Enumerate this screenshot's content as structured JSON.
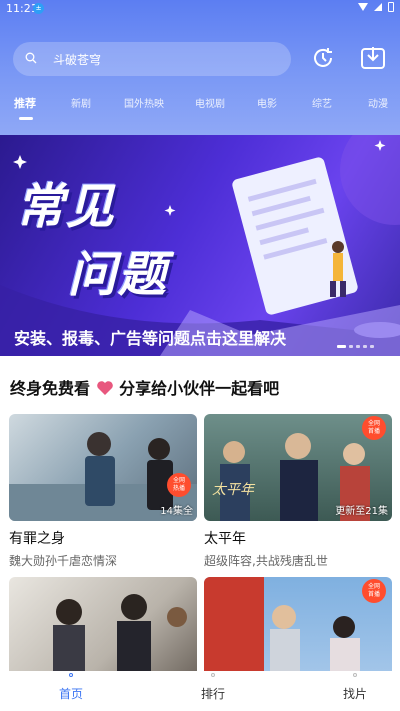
{
  "status": {
    "time": "11:21",
    "notif_glyph": "±"
  },
  "search": {
    "text": "斗破苍穹"
  },
  "tabs": [
    "推荐",
    "新剧",
    "国外热映",
    "电视剧",
    "电影",
    "综艺",
    "动漫"
  ],
  "banner": {
    "title_line1": "常见",
    "title_line2": "问题",
    "caption": "安装、报毒、广告等问题点击这里解决"
  },
  "section": {
    "title_part1": "终身免费看",
    "title_part2": "分享给小伙伴一起看吧"
  },
  "cards": [
    {
      "title": "有罪之身",
      "subtitle": "魏大勋孙千虐恋情深",
      "badge": "14集全",
      "tag": "全网\n热播"
    },
    {
      "title": "太平年",
      "subtitle": "超级阵容,共战残唐乱世",
      "badge": "更新至21集",
      "tag": "全网\n首播"
    },
    {
      "title": "",
      "subtitle": "",
      "badge": "",
      "tag": ""
    },
    {
      "title": "",
      "subtitle": "",
      "badge": "",
      "tag": "全网\n首播"
    }
  ],
  "nav": [
    "首页",
    "排行",
    "找片"
  ],
  "colors": {
    "accent": "#3b74f2",
    "header": "#6a8cf4",
    "banner": "#4d2ed6"
  }
}
